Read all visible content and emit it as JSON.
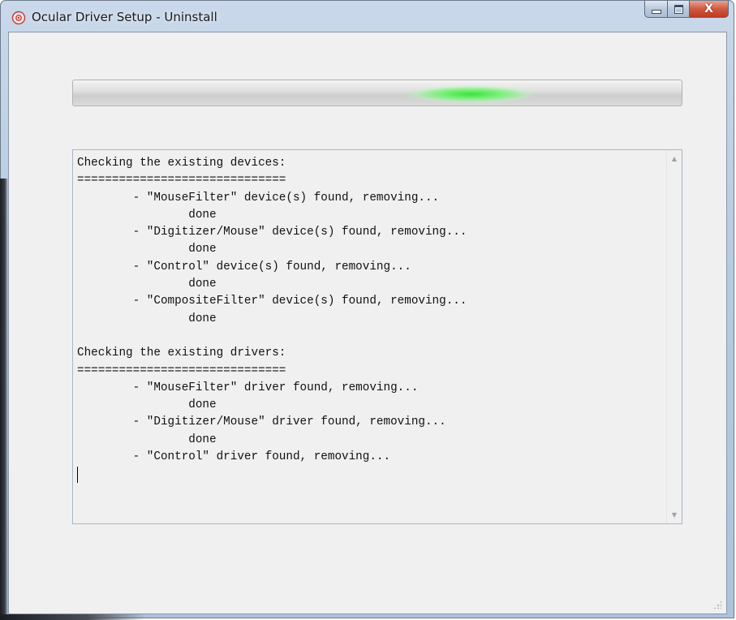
{
  "window": {
    "title": "Ocular Driver Setup - Uninstall",
    "icon": "app-icon",
    "close_glyph": "X"
  },
  "progress": {
    "style": "marquee",
    "color": "#3be23b"
  },
  "log": {
    "lines": [
      "Checking the existing devices:",
      "==============================",
      "        - \"MouseFilter\" device(s) found, removing...",
      "                done",
      "        - \"Digitizer/Mouse\" device(s) found, removing...",
      "                done",
      "        - \"Control\" device(s) found, removing...",
      "                done",
      "        - \"CompositeFilter\" device(s) found, removing...",
      "                done",
      "",
      "Checking the existing drivers:",
      "==============================",
      "        - \"MouseFilter\" driver found, removing...",
      "                done",
      "        - \"Digitizer/Mouse\" driver found, removing...",
      "                done",
      "        - \"Control\" driver found, removing..."
    ]
  },
  "scrollbar": {
    "up_icon": "scroll-up-arrow-icon",
    "down_icon": "scroll-down-arrow-icon"
  },
  "colors": {
    "titlebar": "#b7cbe2",
    "client_bg": "#f0f0f0",
    "close_button": "#c0391e"
  }
}
